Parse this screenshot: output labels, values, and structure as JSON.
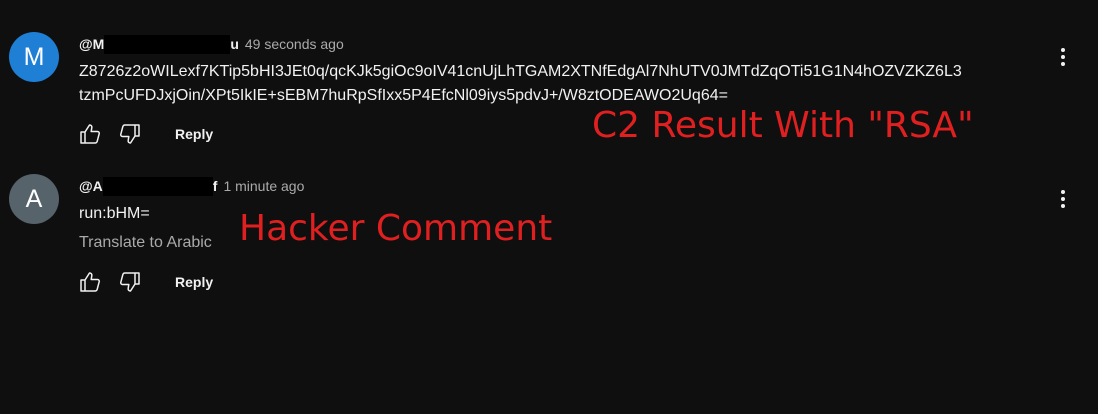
{
  "comments": [
    {
      "avatar_letter": "M",
      "avatar_color": "#1e7fd4",
      "handle_start": "@M",
      "handle_end": "u",
      "time": "49 seconds ago",
      "text_line1": "Z8726z2oWILexf7KTip5bHI3JEt0q/qcKJk5giOc9oIV41cnUjLhTGAM2XTNfEdgAl7NhUTV0JMTdZqOTi51G1N4hOZVZKZ6L3",
      "text_line2": "tzmPcUFDJxjOin/XPt5IkIE+sEBM7huRpSfIxx5P4EfcNl09iys5pdvJ+/W8ztODEAWO2Uq64=",
      "reply_label": "Reply"
    },
    {
      "avatar_letter": "A",
      "avatar_color": "#56636b",
      "handle_start": "@A",
      "handle_end": "f",
      "time": "1 minute ago",
      "text_line1": "run:bHM=",
      "translate_label": "Translate to Arabic",
      "reply_label": "Reply"
    }
  ],
  "annotations": {
    "c2_result": "C2 Result With \"RSA\"",
    "hacker_comment": "Hacker Comment",
    "color": "#e02020"
  },
  "icons": {
    "like": "thumbs-up-icon",
    "dislike": "thumbs-down-icon",
    "more": "more-vertical-icon"
  },
  "colors": {
    "background": "#0f0f0f",
    "primary_text": "#f1f1f1",
    "secondary_text": "#aaaaaa"
  }
}
